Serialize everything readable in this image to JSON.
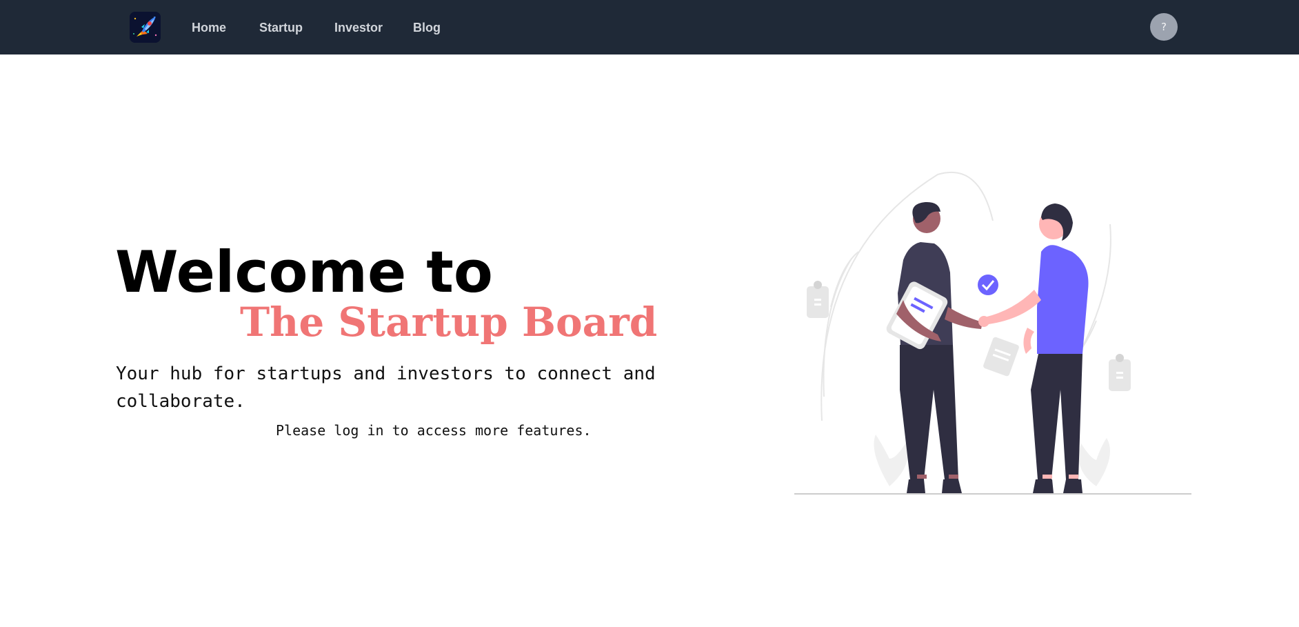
{
  "nav": {
    "logo": "rocket-logo",
    "links": [
      "Home",
      "Startup",
      "Investor",
      "Blog"
    ],
    "help_label": "?"
  },
  "hero": {
    "title": "Welcome to",
    "brand": "The Startup Board",
    "subtitle": "Your hub for startups and investors to connect and collaborate.",
    "note": "Please log in to access more features."
  },
  "illustration": {
    "subject": "handshake-illustration",
    "colors": {
      "accent": "#6c63ff",
      "skin_left": "#a0616a",
      "skin_right": "#ffb6b6",
      "dark": "#2f2e41",
      "light_gray": "#e6e6e6"
    }
  },
  "colors": {
    "navbar_bg": "#1f2937",
    "nav_text": "#d1d5db",
    "brand": "#f07575",
    "avatar_bg": "#9ca3af"
  }
}
